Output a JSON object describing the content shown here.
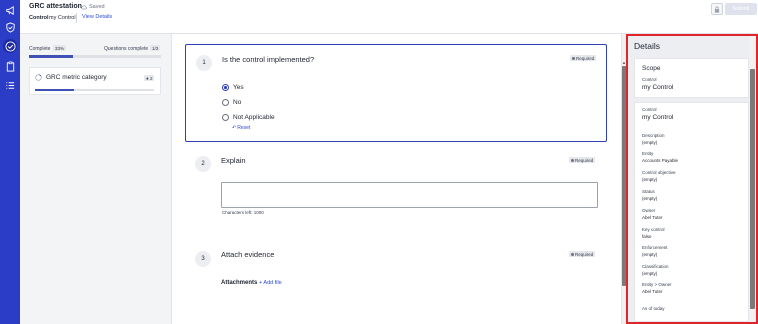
{
  "header": {
    "app_title": "GRC attestation",
    "saved_text": "Saved",
    "control_label": "Control",
    "control_value": "my Control",
    "view_details": "View Details",
    "submit_label": "Submit"
  },
  "progress": {
    "complete_label": "Complete",
    "complete_pct": "33%",
    "complete_fraction": 0.33,
    "questions_label": "Questions complete",
    "questions_value": "1/3"
  },
  "category": {
    "title": "GRC metric category",
    "badge": "2",
    "progress_fraction": 0.33
  },
  "questions": [
    {
      "number": "1",
      "title": "Is the control implemented?",
      "required": "Required",
      "options": [
        "Yes",
        "No",
        "Not Applicable"
      ],
      "selected": "Yes",
      "reset_label": "Reset"
    },
    {
      "number": "2",
      "title": "Explain",
      "required": "Required",
      "chars_left": "Characters left: 1000"
    },
    {
      "number": "3",
      "title": "Attach evidence",
      "required": "Required",
      "attachments_label": "Attachments",
      "add_file_label": "+ Add file"
    }
  ],
  "details": {
    "title": "Details",
    "scope": {
      "title": "Scope",
      "control_label": "Control",
      "control_value": "my Control"
    },
    "fields": [
      {
        "label": "Control",
        "value": "my Control"
      },
      {
        "label": "Description",
        "value": "(empty)"
      },
      {
        "label": "Entity",
        "value": "Accounts Payable"
      },
      {
        "label": "Control objective",
        "value": "(empty)"
      },
      {
        "label": "Status",
        "value": "(empty)"
      },
      {
        "label": "Owner",
        "value": "Abel Tuter"
      },
      {
        "label": "Key control",
        "value": "false"
      },
      {
        "label": "Enforcement",
        "value": "(empty)"
      },
      {
        "label": "Classification",
        "value": "(empty)"
      },
      {
        "label": "Entity > Owner",
        "value": "Abel Tuter"
      },
      {
        "label": "As of today",
        "value": ""
      }
    ]
  },
  "colors": {
    "rail": "#2b3cc6",
    "accent": "#2f3fb4",
    "link": "#2b4bd6",
    "highlight_border": "#e0242b"
  },
  "icons": {
    "rail": [
      "megaphone-icon",
      "shield-icon",
      "check-circle-icon",
      "clipboard-icon",
      "list-icon"
    ]
  }
}
